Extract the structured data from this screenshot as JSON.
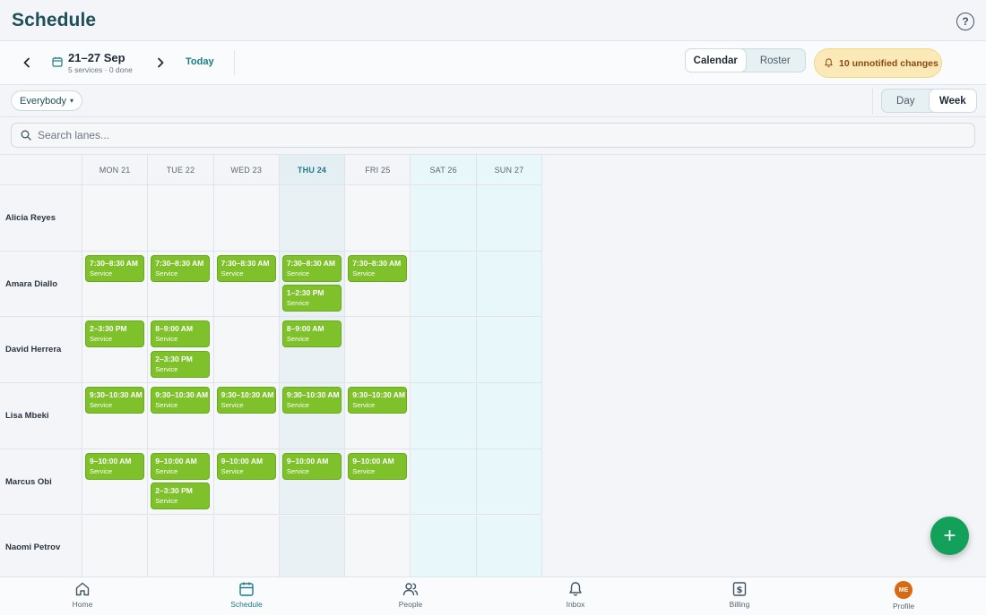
{
  "header": {
    "title": "Schedule"
  },
  "toolbar": {
    "date_range": "21–27 Sep",
    "date_sub": "5 services · 0 done",
    "today_label": "Today",
    "view_options": [
      "Calendar",
      "Roster"
    ],
    "active_view": "Calendar",
    "notification": "10 unnotified changes"
  },
  "filter": {
    "scope_label": "Everybody",
    "period_options": [
      "Day",
      "Week"
    ],
    "active_period": "Week"
  },
  "search": {
    "placeholder": "Search lanes..."
  },
  "days": [
    {
      "label": "MON 21",
      "kind": "normal"
    },
    {
      "label": "TUE 22",
      "kind": "normal"
    },
    {
      "label": "WED 23",
      "kind": "normal"
    },
    {
      "label": "THU 24",
      "kind": "today"
    },
    {
      "label": "FRI 25",
      "kind": "normal"
    },
    {
      "label": "SAT 26",
      "kind": "weekend"
    },
    {
      "label": "SUN 27",
      "kind": "weekend"
    }
  ],
  "lanes": [
    {
      "name": "Alicia Reyes",
      "cells": [
        [],
        [],
        [],
        [],
        [],
        [],
        []
      ]
    },
    {
      "name": "Amara Diallo",
      "cells": [
        [
          {
            "time": "7:30–8:30 AM",
            "label": "Service"
          }
        ],
        [
          {
            "time": "7:30–8:30 AM",
            "label": "Service"
          }
        ],
        [
          {
            "time": "7:30–8:30 AM",
            "label": "Service"
          }
        ],
        [
          {
            "time": "7:30–8:30 AM",
            "label": "Service"
          },
          {
            "time": "1–2:30 PM",
            "label": "Service"
          }
        ],
        [
          {
            "time": "7:30–8:30 AM",
            "label": "Service"
          }
        ],
        [],
        []
      ]
    },
    {
      "name": "David Herrera",
      "cells": [
        [
          {
            "time": "2–3:30 PM",
            "label": "Service"
          }
        ],
        [
          {
            "time": "8–9:00 AM",
            "label": "Service"
          },
          {
            "time": "2–3:30 PM",
            "label": "Service"
          }
        ],
        [],
        [
          {
            "time": "8–9:00 AM",
            "label": "Service"
          }
        ],
        [],
        [],
        []
      ]
    },
    {
      "name": "Lisa Mbeki",
      "cells": [
        [
          {
            "time": "9:30–10:30 AM",
            "label": "Service"
          }
        ],
        [
          {
            "time": "9:30–10:30 AM",
            "label": "Service"
          }
        ],
        [
          {
            "time": "9:30–10:30 AM",
            "label": "Service"
          }
        ],
        [
          {
            "time": "9:30–10:30 AM",
            "label": "Service"
          }
        ],
        [
          {
            "time": "9:30–10:30 AM",
            "label": "Service"
          }
        ],
        [],
        []
      ]
    },
    {
      "name": "Marcus Obi",
      "cells": [
        [
          {
            "time": "9–10:00 AM",
            "label": "Service"
          }
        ],
        [
          {
            "time": "9–10:00 AM",
            "label": "Service"
          },
          {
            "time": "2–3:30 PM",
            "label": "Service"
          }
        ],
        [
          {
            "time": "9–10:00 AM",
            "label": "Service"
          }
        ],
        [
          {
            "time": "9–10:00 AM",
            "label": "Service"
          }
        ],
        [
          {
            "time": "9–10:00 AM",
            "label": "Service"
          }
        ],
        [],
        []
      ]
    },
    {
      "name": "Naomi Petrov",
      "cells": [
        [],
        [],
        [],
        [],
        [],
        [],
        []
      ]
    }
  ],
  "fab": {
    "icon": "plus-icon",
    "label": "+"
  },
  "tabbar": [
    {
      "label": "Home",
      "icon": "home-icon",
      "active": false
    },
    {
      "label": "Schedule",
      "icon": "calendar-icon",
      "active": true
    },
    {
      "label": "People",
      "icon": "people-icon",
      "active": false
    },
    {
      "label": "Inbox",
      "icon": "bell-icon",
      "active": false
    },
    {
      "label": "Billing",
      "icon": "dollar-icon",
      "active": false
    },
    {
      "label": "Profile",
      "icon": "avatar",
      "active": false,
      "initials": "ME"
    }
  ],
  "colors": {
    "accent": "#1d7a8a",
    "event": "#7ec12a",
    "fab": "#12a05a",
    "notify_bg": "#fbeab8",
    "avatar": "#d86a12"
  }
}
